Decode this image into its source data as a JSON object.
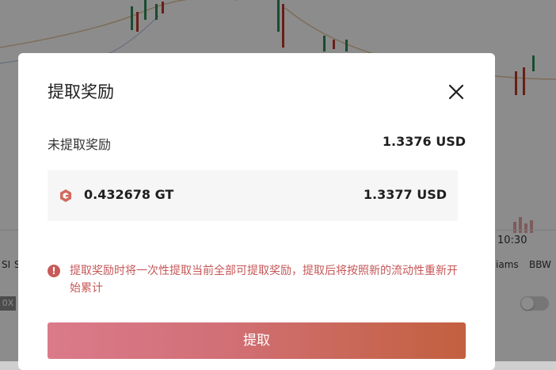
{
  "background": {
    "time_label": "10:30",
    "indicators": [
      "iams",
      "BBW"
    ],
    "left_labels": [
      "SI",
      "S"
    ],
    "badge_text": "0X"
  },
  "modal": {
    "title": "提取奖励",
    "pending_label": "未提取奖励",
    "pending_value": "1.3376 USD",
    "reward_amount": "0.432678 GT",
    "reward_usd": "1.3377 USD",
    "notice_text": "提取奖励时将一次性提取当前全部可提取奖励，提取后将按照新的流动性重新开始累计",
    "withdraw_label": "提取"
  },
  "icons": {
    "close": "close-icon",
    "token": "gt-token-icon",
    "warning": "warning-icon"
  },
  "colors": {
    "accent_start": "#db7a8a",
    "accent_end": "#c2603f",
    "warning": "#c65757"
  }
}
